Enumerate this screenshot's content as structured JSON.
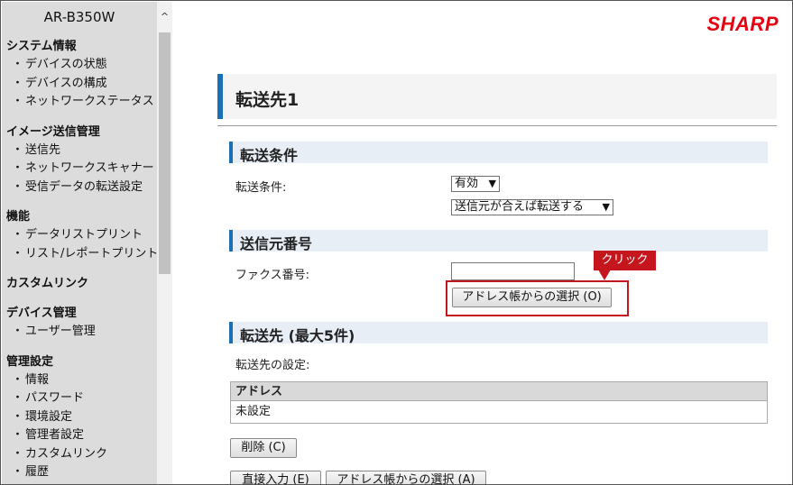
{
  "sidebar": {
    "model": "AR-B350W",
    "groups": [
      {
        "title": "システム情報",
        "items": [
          "デバイスの状態",
          "デバイスの構成",
          "ネットワークステータス"
        ]
      },
      {
        "title": "イメージ送信管理",
        "items": [
          "送信先",
          "ネットワークスキャナー",
          "受信データの転送設定"
        ]
      },
      {
        "title": "機能",
        "items": [
          "データリストプリント",
          "リスト/レポートプリント"
        ]
      },
      {
        "title": "カスタムリンク",
        "items": []
      },
      {
        "title": "デバイス管理",
        "items": [
          "ユーザー管理"
        ]
      },
      {
        "title": "管理設定",
        "items": [
          "情報",
          "パスワード",
          "環境設定",
          "管理者設定",
          "カスタムリンク",
          "履歴"
        ]
      }
    ],
    "scroll_up_glyph": "^"
  },
  "header": {
    "logo": "SHARP"
  },
  "page": {
    "title": "転送先1"
  },
  "sections": {
    "forward_condition": {
      "title": "転送条件",
      "label": "転送条件:",
      "select1_value": "有効",
      "select2_value": "送信元が合えば転送する"
    },
    "sender_number": {
      "title": "送信元番号",
      "fax_label": "ファクス番号:",
      "fax_value": "",
      "address_book_button": "アドレス帳からの選択 (O)"
    },
    "destinations": {
      "title": "転送先 (最大5件)",
      "setting_label": "転送先の設定:",
      "table_header": "アドレス",
      "table_rows": [
        "未設定"
      ],
      "delete_button": "削除 (C)",
      "direct_input_button": "直接入力 (E)",
      "address_book_button": "アドレス帳からの選択 (A)"
    }
  },
  "annotation": {
    "callout_text": "クリック",
    "color": "#c4161c"
  },
  "colors": {
    "accent": "#1a6fb5",
    "brand": "#e60012"
  }
}
